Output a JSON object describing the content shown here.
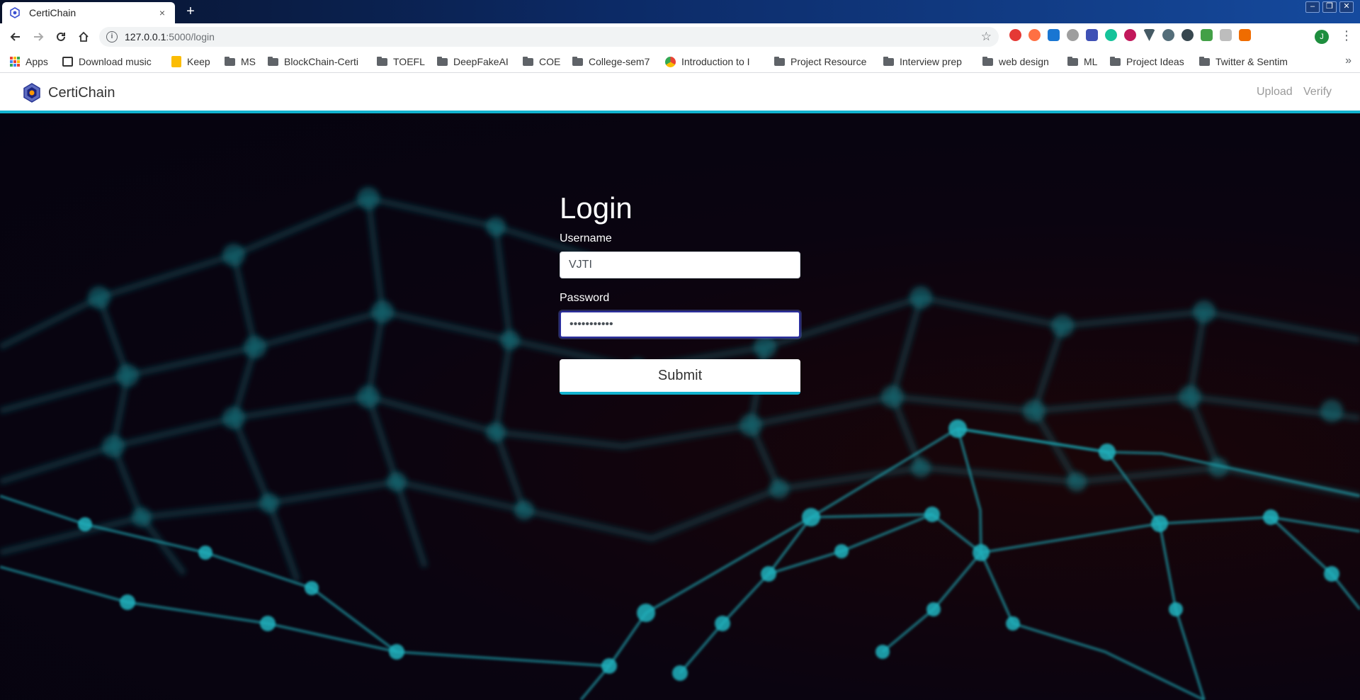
{
  "browser": {
    "tab_title": "CertiChain",
    "tab_close": "×",
    "new_tab": "+",
    "window_controls": [
      "–",
      "❐",
      "✕"
    ],
    "url_host": "127.0.0.1",
    "url_path": ":5000/login",
    "profile_initial": "J",
    "bookmarks": [
      {
        "label": "Apps",
        "icon": "apps-grid-icon"
      },
      {
        "label": "Download music",
        "icon": "page-icon"
      },
      {
        "label": "Keep",
        "icon": "keep-icon"
      },
      {
        "label": "MS",
        "icon": "folder-icon"
      },
      {
        "label": "BlockChain-Certi",
        "icon": "folder-icon"
      },
      {
        "label": "TOEFL",
        "icon": "folder-icon"
      },
      {
        "label": "DeepFakeAI",
        "icon": "folder-icon"
      },
      {
        "label": "COE",
        "icon": "folder-icon"
      },
      {
        "label": "College-sem7",
        "icon": "folder-icon"
      },
      {
        "label": "Introduction to I",
        "icon": "chrome-icon"
      },
      {
        "label": "Project Resource",
        "icon": "folder-icon"
      },
      {
        "label": "Interview prep",
        "icon": "folder-icon"
      },
      {
        "label": "web design",
        "icon": "folder-icon"
      },
      {
        "label": "ML",
        "icon": "folder-icon"
      },
      {
        "label": "Project Ideas",
        "icon": "folder-icon"
      },
      {
        "label": "Twitter & Sentim",
        "icon": "folder-icon"
      }
    ],
    "bookmarks_overflow": "»"
  },
  "navbar": {
    "brand": "CertiChain",
    "links": [
      "Upload",
      "Verify"
    ]
  },
  "login": {
    "heading": "Login",
    "username_label": "Username",
    "username_value": "VJTI",
    "password_label": "Password",
    "password_masked": "•••••••••••",
    "submit_label": "Submit"
  },
  "colors": {
    "accent": "#12b3cf",
    "background": "#05030d",
    "network": "#1a8a95"
  }
}
